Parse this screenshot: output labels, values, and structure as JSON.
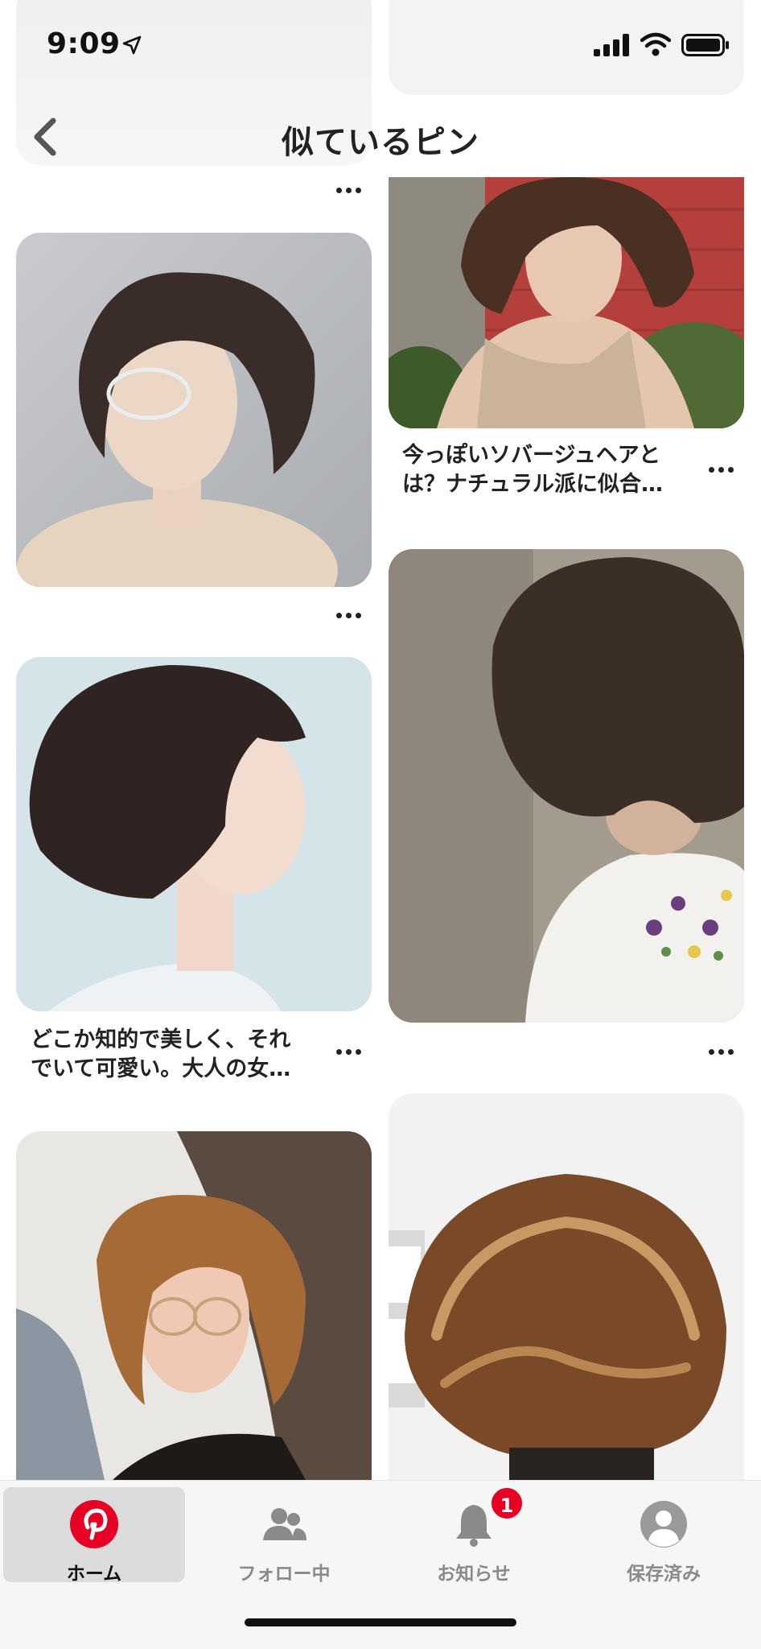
{
  "status_bar": {
    "time": "9:09"
  },
  "header": {
    "title": "似ているピン"
  },
  "pins": {
    "p1_caption_line1": "今っぽいソバージュヘアと",
    "p1_caption_line2": "は？ナチュラル派に似合…",
    "p2_caption_line1": "どこか知的で美しく、それ",
    "p2_caption_line2": "でいて可愛い。大人の女…"
  },
  "tabbar": {
    "home": "ホーム",
    "following": "フォロー中",
    "notifications": "お知らせ",
    "saved": "保存済み",
    "notification_count": "1"
  },
  "colors": {
    "brand_red": "#e60023",
    "tab_active_bg": "#dcdcdc"
  }
}
